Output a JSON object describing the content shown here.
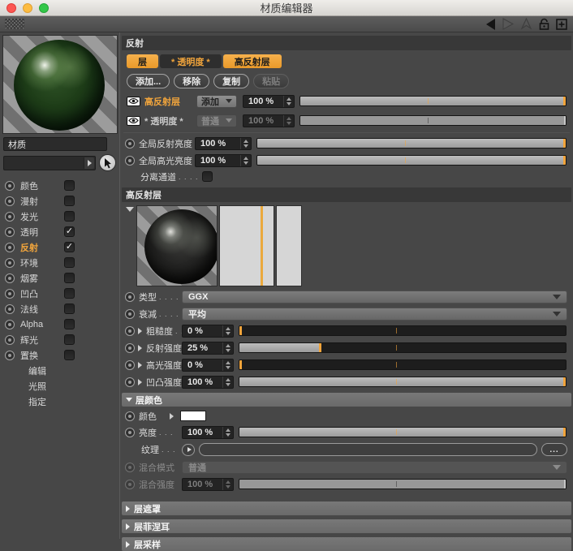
{
  "window": {
    "title": "材质编辑器"
  },
  "sidebar": {
    "material_name": "材质",
    "channels": [
      {
        "label": "颜色",
        "check": ""
      },
      {
        "label": "漫射",
        "check": ""
      },
      {
        "label": "发光",
        "check": ""
      },
      {
        "label": "透明",
        "check": "✓"
      },
      {
        "label": "反射",
        "check": "✓",
        "selected": true
      },
      {
        "label": "环境",
        "check": ""
      },
      {
        "label": "烟雾",
        "check": ""
      },
      {
        "label": "凹凸",
        "check": ""
      },
      {
        "label": "法线",
        "check": ""
      },
      {
        "label": "Alpha",
        "check": ""
      },
      {
        "label": "辉光",
        "check": ""
      },
      {
        "label": "置换",
        "check": ""
      }
    ],
    "extras": [
      {
        "label": "编辑"
      },
      {
        "label": "光照"
      },
      {
        "label": "指定"
      }
    ]
  },
  "panel": {
    "header": "反射",
    "tabs": [
      {
        "label": "层",
        "active": true
      },
      {
        "label": "* 透明度 *",
        "active": false
      },
      {
        "label": "高反射层",
        "active": true
      }
    ],
    "buttons": [
      {
        "label": "添加...",
        "enabled": true
      },
      {
        "label": "移除",
        "enabled": true
      },
      {
        "label": "复制",
        "enabled": true
      },
      {
        "label": "粘贴",
        "enabled": false
      }
    ],
    "layers": [
      {
        "name": "高反射层",
        "blend": "添加",
        "value": "100 %",
        "percent": 100,
        "enabled": true
      },
      {
        "name": "* 透明度 *",
        "blend": "普通",
        "value": "100 %",
        "percent": 100,
        "enabled": false
      }
    ],
    "globals": [
      {
        "label": "全局反射亮度",
        "value": "100 %",
        "percent": 100
      },
      {
        "label": "全局高光亮度",
        "value": "100 %",
        "percent": 100
      }
    ],
    "separate_pass": {
      "label": "分离通道",
      "dots": ". . . ."
    },
    "layer_section": {
      "title": "高反射层",
      "type": {
        "label": "类型",
        "dots": ". . . . .",
        "value": "GGX"
      },
      "atten": {
        "label": "衰减",
        "dots": ". . . . .",
        "value": "平均"
      },
      "params": [
        {
          "label": "粗糙度",
          "dots": ". .",
          "value": "0 %",
          "percent": 0
        },
        {
          "label": "反射强度",
          "dots": "",
          "value": "25 %",
          "percent": 25
        },
        {
          "label": "高光强度",
          "dots": "",
          "value": "0 %",
          "percent": 0
        },
        {
          "label": "凹凸强度",
          "dots": "",
          "value": "100 %",
          "percent": 100
        }
      ]
    },
    "layer_color": {
      "title": "层颜色",
      "color_label": "颜色",
      "brightness": {
        "label": "亮度",
        "dots": ". . .",
        "value": "100 %",
        "percent": 100
      },
      "texture": {
        "label": "纹理",
        "dots": ". . .",
        "browse": "..."
      },
      "mix_mode": {
        "label": "混合模式",
        "value": "普通"
      },
      "mix_strength": {
        "label": "混合强度",
        "value": "100 %",
        "percent": 100
      }
    },
    "collapsed_sections": [
      {
        "label": "层遮罩"
      },
      {
        "label": "层菲涅耳"
      },
      {
        "label": "层采样"
      }
    ]
  },
  "colors": {
    "accent_orange": "#F0A43C",
    "panel_bg": "#474747",
    "bar_dark": "#383838",
    "bar_light": "#707070"
  }
}
